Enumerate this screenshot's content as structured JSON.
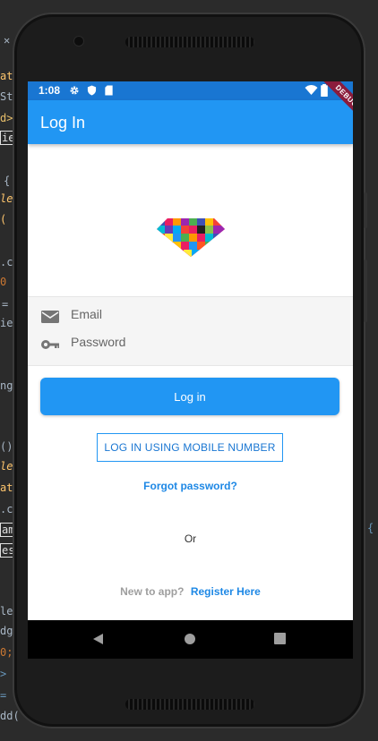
{
  "ide_background": {
    "fragments": [
      "ate",
      "Sty",
      "d>",
      "ie",
      "{",
      "lem",
      "(",
      ".cl",
      "0",
      "=",
      "ie",
      "nge",
      "()",
      "lem",
      "ate",
      ".cl",
      "ame",
      "es",
      "{",
      "lem",
      "dge",
      "0;",
      "> ",
      "=",
      "dd("
    ]
  },
  "status_bar": {
    "time": "1:08",
    "icons": [
      "gear-icon",
      "shield-icon",
      "sd-card-icon",
      "wifi-icon",
      "battery-icon"
    ]
  },
  "debug_banner": "DEBUG",
  "app_bar": {
    "title": "Log In"
  },
  "form": {
    "email": {
      "placeholder": "Email",
      "value": "",
      "icon": "mail-icon"
    },
    "password": {
      "placeholder": "Password",
      "value": "",
      "icon": "key-icon"
    }
  },
  "buttons": {
    "login": "Log in",
    "mobile_login": "LOG IN USING MOBILE NUMBER",
    "forgot_password": "Forgot password?"
  },
  "divider_text": "Or",
  "register": {
    "prompt": "New to app?",
    "link": "Register Here"
  },
  "nav_bar": {
    "icons": [
      "back-icon",
      "home-icon",
      "recents-icon"
    ]
  },
  "colors": {
    "app_bar": "#2196f3",
    "status_bar": "#1976d2",
    "link": "#1e88e5",
    "debug_ribbon": "#8b1c3c"
  }
}
